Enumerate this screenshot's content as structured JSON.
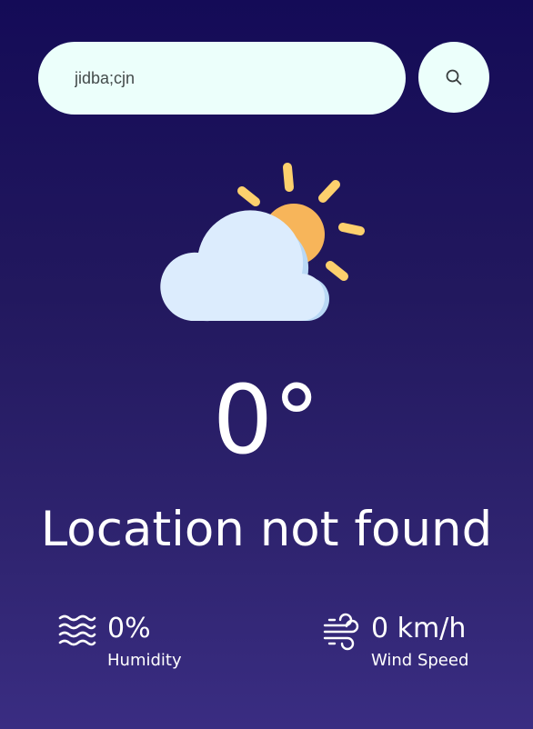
{
  "search": {
    "value": "jidba;cjn",
    "placeholder": "",
    "icon": "search-icon"
  },
  "weather": {
    "icon": "partly-cloudy-icon",
    "temperature": "0°",
    "city": "Location not found"
  },
  "details": {
    "humidity": {
      "icon": "humidity-icon",
      "value": "0%",
      "label": "Humidity"
    },
    "wind": {
      "icon": "wind-icon",
      "value": "0 km/h",
      "label": "Wind Speed"
    }
  },
  "colors": {
    "background_top": "#140b57",
    "background_bottom": "#3a2d82",
    "search_bg": "#ecfffb",
    "sun": "#f7b55a",
    "sun_rays": "#fdd06d",
    "cloud": "#dcecfd",
    "cloud_shadow": "#b9d8f5"
  }
}
